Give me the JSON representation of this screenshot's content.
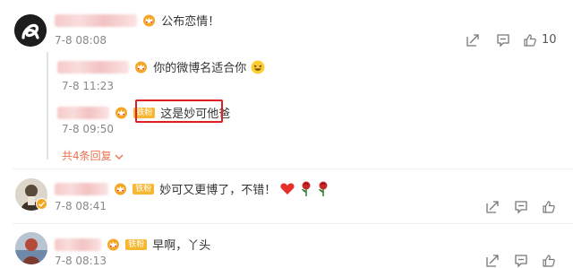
{
  "comments": [
    {
      "text": "公布恋情！",
      "time": "7-8 08:08",
      "likes": "10",
      "replies": [
        {
          "text": "你的微博名适合你",
          "time": "7-8 11:23"
        },
        {
          "badge": "铁粉",
          "text": "这是妙可他爸",
          "time": "7-8 09:50"
        }
      ],
      "expand_label": "共4条回复"
    },
    {
      "badge": "铁粉",
      "text": "妙可又更博了，不错！",
      "time": "7-8 08:41"
    },
    {
      "badge": "铁粉",
      "text": "早啊，丫头",
      "time": "7-8 08:13"
    }
  ],
  "icons": [
    "share-icon",
    "comment-icon",
    "like-icon",
    "expand-chevron-icon"
  ],
  "colors": {
    "highlight": "#e02020",
    "link": "#eb7350",
    "badge": "#f7b731"
  }
}
